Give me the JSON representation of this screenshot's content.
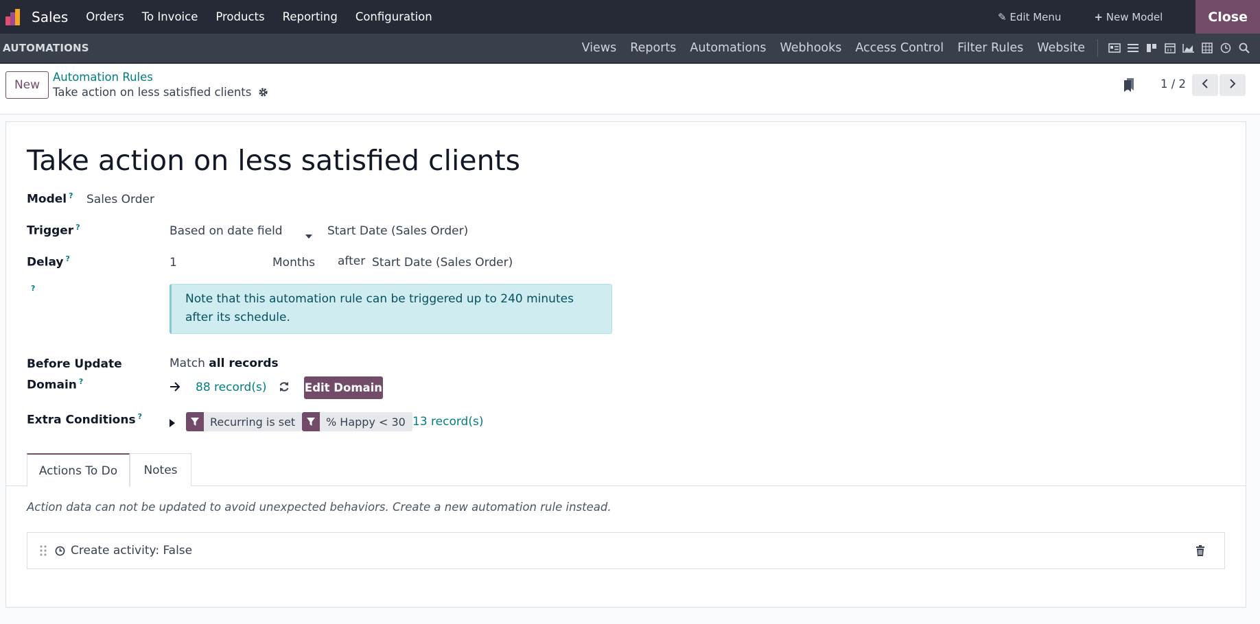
{
  "navbar": {
    "app_name": "Sales",
    "menu": [
      "Orders",
      "To Invoice",
      "Products",
      "Reporting",
      "Configuration"
    ],
    "edit_menu": "Edit Menu",
    "new_model": "New Model",
    "close": "Close"
  },
  "studio": {
    "title": "AUTOMATIONS",
    "links": [
      "Views",
      "Reports",
      "Automations",
      "Webhooks",
      "Access Control",
      "Filter Rules",
      "Website"
    ]
  },
  "control_panel": {
    "new_label": "New",
    "breadcrumb": "Automation Rules",
    "record_name": "Take action on less satisfied clients",
    "pager": "1 / 2"
  },
  "form": {
    "title": "Take action on less satisfied clients",
    "model_label": "Model",
    "model_value": "Sales Order",
    "trigger_label": "Trigger",
    "trigger_value": "Based on date field",
    "trigger_date_field": "Start Date (Sales Order)",
    "delay_label": "Delay",
    "delay_value": "1",
    "delay_unit": "Months",
    "delay_after": "after",
    "delay_field": "Start Date (Sales Order)",
    "help_mark": "?",
    "alert": "Note that this automation rule can be triggered up to 240 minutes after its schedule.",
    "before_update_label_1": "Before Update",
    "before_update_label_2": "Domain",
    "match_prefix": "Match",
    "match_bold": "all records",
    "domain_count": "88 record(s)",
    "edit_domain": "Edit Domain",
    "extra_conditions_label": "Extra Conditions",
    "conditions": [
      "Recurring is set",
      "% Happy < 30"
    ],
    "conditions_count": "13 record(s)"
  },
  "notebook": {
    "tabs": [
      "Actions To Do",
      "Notes"
    ],
    "note": "Action data can not be updated to avoid unexpected behaviors. Create a new automation rule instead.",
    "actions": [
      {
        "label": "Create activity: False"
      }
    ]
  },
  "colors": {
    "brand": "#714b67",
    "link": "#017e84",
    "navbar": "#262a36"
  }
}
